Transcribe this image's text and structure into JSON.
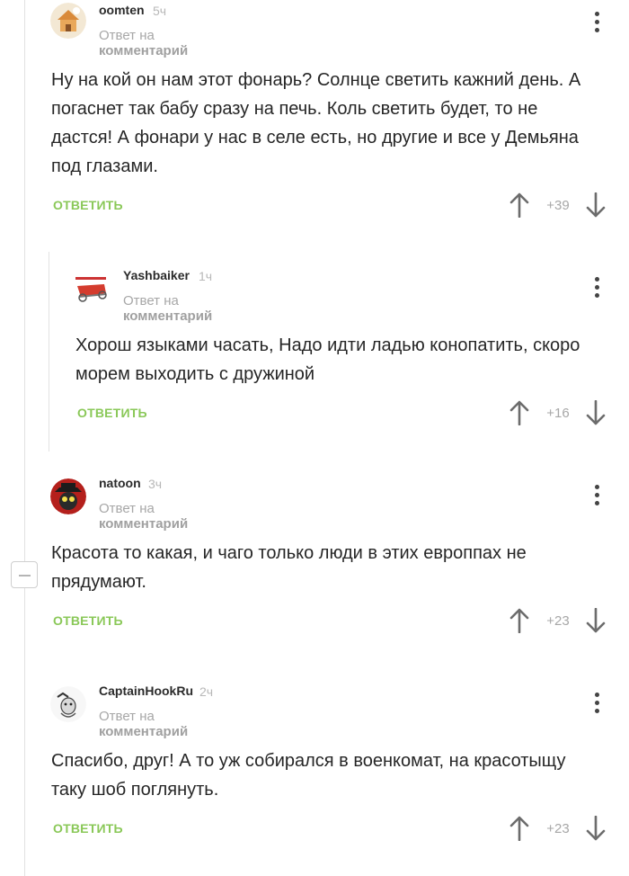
{
  "comments": [
    {
      "author": "oomten",
      "time": "5ч",
      "meta_prefix": "Ответ на",
      "meta_link": "комментарий",
      "text": "Ну на кой он нам этот фонарь? Солнце светить кажний день. А погаснет так бабу сразу на печь. Коль светить будет, то не дастся! А фонари у нас в селе есть, но другие и все у Демьяна под глазами.",
      "reply_label": "ОТВЕТИТЬ",
      "score": "+39"
    },
    {
      "author": "Yashbaiker",
      "time": "1ч",
      "meta_prefix": "Ответ на",
      "meta_link": "комментарий",
      "text": "Хорош языками часать, Надо идти ладью конопатить, скоро морем выходить с дружиной",
      "reply_label": "ОТВЕТИТЬ",
      "score": "+16"
    },
    {
      "author": "natoon",
      "time": "3ч",
      "meta_prefix": "Ответ на",
      "meta_link": "комментарий",
      "text": "Красота то какая, и чаго только люди в этих европпах не прядумают.",
      "reply_label": "ОТВЕТИТЬ",
      "score": "+23"
    },
    {
      "author": "CaptainHookRu",
      "time": "2ч",
      "meta_prefix": "Ответ на",
      "meta_link": "комментарий",
      "text": "Спасибо, друг! А то уж собирался в военкомат, на красотыщу таку шоб поглянуть.",
      "reply_label": "ОТВЕТИТЬ",
      "score": "+23"
    }
  ],
  "colors": {
    "reply_green": "#8ac858",
    "muted_gray": "#a7a7a7",
    "thread_line": "#e2e2e2"
  },
  "icons": [
    "arrow-up-icon",
    "arrow-down-icon",
    "more-vertical-icon",
    "collapse-minus-icon"
  ]
}
